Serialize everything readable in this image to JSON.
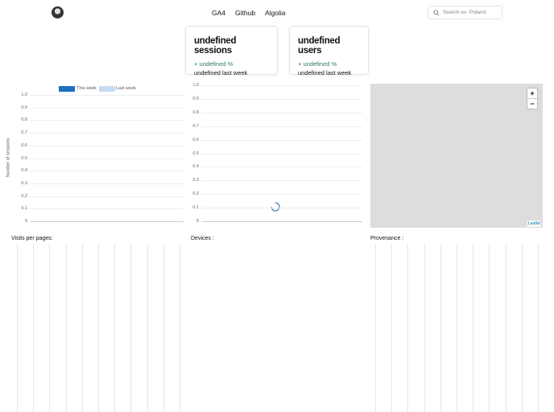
{
  "header": {
    "nav": [
      "GA4",
      "Github",
      "Algolia"
    ],
    "search_placeholder": "Search ex: Poland"
  },
  "cards": [
    {
      "title": "undefined sessions",
      "change": "+ undefined %",
      "last": "undefined last week"
    },
    {
      "title": "undefined users",
      "change": "+ undefined %",
      "last": "undefined last week"
    }
  ],
  "chart_data": [
    {
      "type": "bar",
      "title": "",
      "legend": [
        "This week",
        "Last week"
      ],
      "legend_position": "top",
      "ylabel": "Number of sessions",
      "xlabel": "",
      "ylim": [
        0,
        1
      ],
      "yticks": [
        "1.0",
        "0.9",
        "0.8",
        "0.7",
        "0.6",
        "0.5",
        "0.4",
        "0.3",
        "0.2",
        "0.1",
        "0"
      ],
      "series": [
        {
          "name": "This week",
          "color": "#1f6fc0",
          "values": []
        },
        {
          "name": "Last week",
          "color": "#c6dcf2",
          "values": []
        }
      ]
    },
    {
      "type": "line",
      "title": "",
      "ylim": [
        0,
        1
      ],
      "yticks": [
        "1.0",
        "0.9",
        "0.8",
        "0.7",
        "0.6",
        "0.5",
        "0.4",
        "0.3",
        "0.2",
        "0.1",
        "0"
      ],
      "series": []
    }
  ],
  "map": {
    "zoom_in": "+",
    "zoom_out": "−",
    "attribution": "Leaflet"
  },
  "sections": {
    "pages": "Visits per pages:",
    "devices": "Devices :",
    "provenance": "Provenance :"
  }
}
